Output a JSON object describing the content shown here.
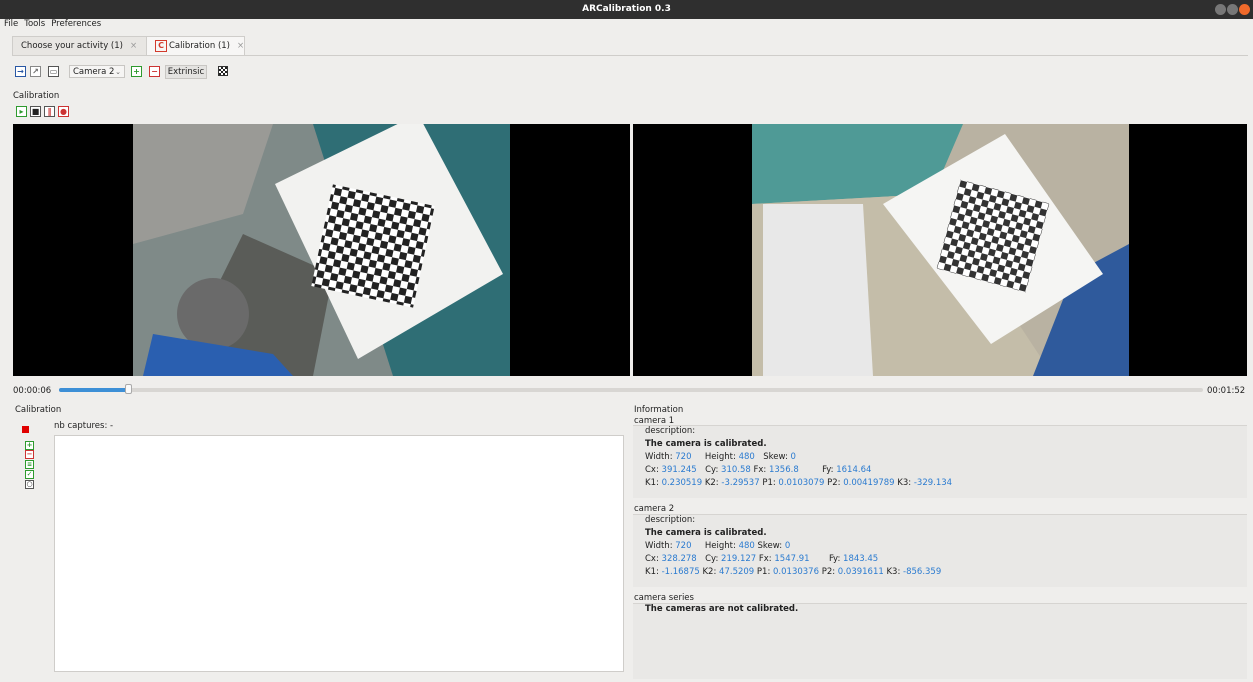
{
  "window": {
    "title": "ARCalibration 0.3"
  },
  "menu": [
    "File",
    "Tools",
    "Preferences"
  ],
  "tabs": [
    {
      "label": "Choose your activity (1)",
      "close": "×"
    },
    {
      "label": "Calibration (1)",
      "close": "×",
      "icon_letter": "C"
    }
  ],
  "toolbar": {
    "camera_select": "Camera 2",
    "extrinsic_label": "Extrinsic"
  },
  "calibration_section_label": "Calibration",
  "player": {
    "current_time": "00:00:06",
    "total_time": "00:01:52",
    "progress": 0.06
  },
  "calibration_panel": {
    "title": "Calibration",
    "nb_captures_label": "nb captures:",
    "nb_captures_value": "-"
  },
  "information": {
    "title": "Information",
    "camera1": {
      "title": "camera 1",
      "description_label": "description:",
      "status": "The camera is calibrated.",
      "width_label": "Width:",
      "width": "720",
      "height_label": "Height:",
      "height": "480",
      "skew_label": "Skew:",
      "skew": "0",
      "cx_label": "Cx:",
      "cx": "391.245",
      "cy_label": "Cy:",
      "cy": "310.58",
      "fx_label": "Fx:",
      "fx": "1356.8",
      "fy_label": "Fy:",
      "fy": "1614.64",
      "k1_label": "K1:",
      "k1": "0.230519",
      "k2_label": "K2:",
      "k2": "-3.29537",
      "p1_label": "P1:",
      "p1": "0.0103079",
      "p2_label": "P2:",
      "p2": "0.00419789",
      "k3_label": "K3:",
      "k3": "-329.134"
    },
    "camera2": {
      "title": "camera 2",
      "description_label": "description:",
      "status": "The camera is calibrated.",
      "width_label": "Width:",
      "width": "720",
      "height_label": "Height:",
      "height": "480",
      "skew_label": "Skew:",
      "skew": "0",
      "cx_label": "Cx:",
      "cx": "328.278",
      "cy_label": "Cy:",
      "cy": "219.127",
      "fx_label": "Fx:",
      "fx": "1547.91",
      "fy_label": "Fy:",
      "fy": "1843.45",
      "k1_label": "K1:",
      "k1": "-1.16875",
      "k2_label": "K2:",
      "k2": "47.5209",
      "p1_label": "P1:",
      "p1": "0.0130376",
      "p2_label": "P2:",
      "p2": "0.0391611",
      "k3_label": "K3:",
      "k3": "-856.359"
    },
    "series": {
      "title": "camera series",
      "status": "The cameras are not calibrated."
    }
  },
  "colors": {
    "accent": "#3d8fd6",
    "value_blue": "#2b7bd0",
    "stop_red": "#e00000",
    "titlebar": "#2f2f2f"
  }
}
